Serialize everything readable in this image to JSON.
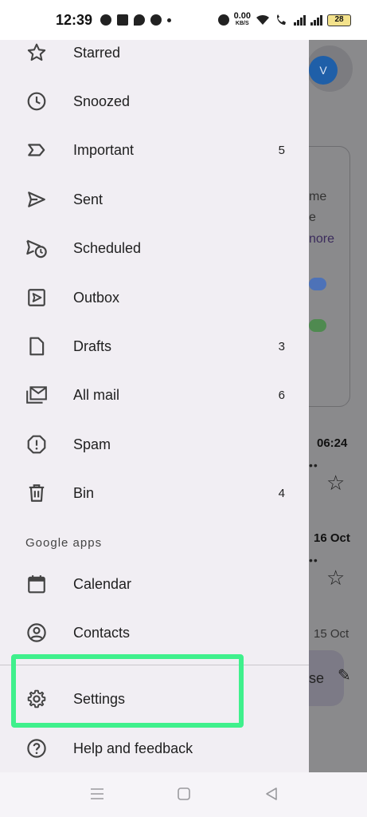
{
  "status_bar": {
    "time": "12:39",
    "net_speed_value": "0.00",
    "net_speed_unit": "KB/S",
    "battery": "28"
  },
  "drawer": {
    "items_top": [
      {
        "name": "starred",
        "label": "Starred",
        "count": "",
        "icon": "star-icon"
      },
      {
        "name": "snoozed",
        "label": "Snoozed",
        "count": "",
        "icon": "clock-icon"
      },
      {
        "name": "important",
        "label": "Important",
        "count": "5",
        "icon": "important-label-icon"
      },
      {
        "name": "sent",
        "label": "Sent",
        "count": "",
        "icon": "send-icon"
      },
      {
        "name": "scheduled",
        "label": "Scheduled",
        "count": "",
        "icon": "schedule-send-icon"
      },
      {
        "name": "outbox",
        "label": "Outbox",
        "count": "",
        "icon": "outbox-icon"
      },
      {
        "name": "drafts",
        "label": "Drafts",
        "count": "3",
        "icon": "draft-icon"
      },
      {
        "name": "all-mail",
        "label": "All mail",
        "count": "6",
        "icon": "all-mail-icon"
      },
      {
        "name": "spam",
        "label": "Spam",
        "count": "",
        "icon": "spam-icon"
      },
      {
        "name": "bin",
        "label": "Bin",
        "count": "4",
        "icon": "trash-icon"
      }
    ],
    "google_apps_label": "Google apps",
    "google_apps": [
      {
        "name": "calendar",
        "label": "Calendar",
        "icon": "calendar-icon"
      },
      {
        "name": "contacts",
        "label": "Contacts",
        "icon": "contacts-icon"
      }
    ],
    "settings_label": "Settings",
    "help_label": "Help and feedback"
  },
  "background": {
    "avatar_letter": "V",
    "card_lines": [
      "me",
      "e",
      "nore"
    ],
    "mail_times": [
      "06:24",
      "16 Oct",
      "15 Oct"
    ],
    "fab_text": "se"
  },
  "colors": {
    "drawer_bg": "#f1eef3",
    "highlight": "#3ff08c",
    "avatar": "#1f5fa8"
  }
}
